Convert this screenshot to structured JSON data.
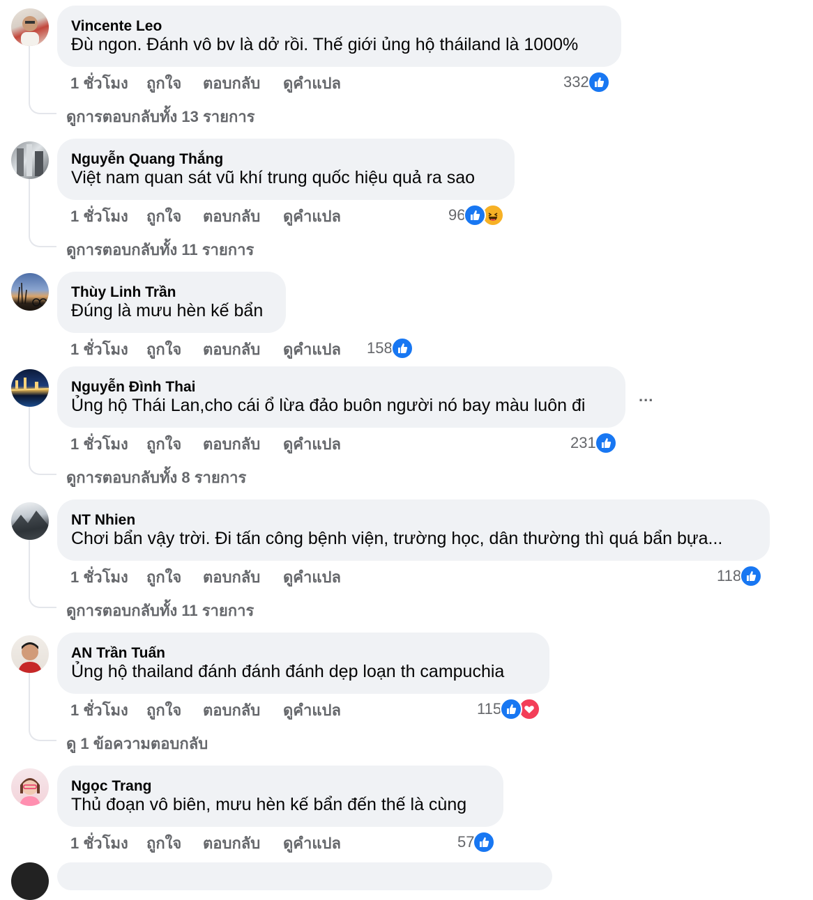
{
  "labels": {
    "time": "1 ชั่วโมง",
    "like": "ถูกใจ",
    "reply": "ตอบกลับ",
    "translate": "ดูคำแปล"
  },
  "colors": {
    "like": "#1877f2",
    "haha": "#f7b125",
    "love": "#f33e58",
    "bubble": "#f0f2f5",
    "muted": "#65676b"
  },
  "comments": [
    {
      "author": "Vincente Leo",
      "text": "Đù ngon. Đánh vô bv là dở rồi. Thế giới ủng hộ tháiland là 1000%",
      "count": "332",
      "reactions": [
        "like-icon"
      ],
      "replies": "ดูการตอบกลับทั้ง 13 รายการ"
    },
    {
      "author": "Nguyễn Quang Thắng",
      "text": "Việt nam quan sát vũ khí trung quốc hiệu quả ra sao",
      "count": "96",
      "reactions": [
        "like-icon",
        "haha-icon"
      ],
      "replies": "ดูการตอบกลับทั้ง 11 รายการ"
    },
    {
      "author": "Thùy Linh Trần",
      "text": "Đúng là mưu hèn kế bẩn",
      "count": "158",
      "reactions": [
        "like-icon"
      ],
      "replies": ""
    },
    {
      "author": "Nguyễn Đình Thai",
      "text": "Ủng hộ Thái Lan,cho cái ổ lừa đảo buôn người nó bay màu luôn đi",
      "count": "231",
      "reactions": [
        "like-icon"
      ],
      "replies": "ดูการตอบกลับทั้ง 8 รายการ",
      "more": "..."
    },
    {
      "author": "NT Nhien",
      "text": "Chơi bẩn vậy trời. Đi tấn công bệnh viện, trường học, dân thường thì quá bẩn bựa...",
      "count": "118",
      "reactions": [
        "like-icon"
      ],
      "replies": "ดูการตอบกลับทั้ง 11 รายการ"
    },
    {
      "author": "AN Trần Tuấn",
      "text": "Ủng hộ thailand đánh đánh đánh dẹp loạn th campuchia",
      "count": "115",
      "reactions": [
        "like-icon",
        "love-icon"
      ],
      "replies": "ดู 1 ข้อความตอบกลับ"
    },
    {
      "author": "Ngọc Trang",
      "text": "Thủ đoạn vô biên, mưu hèn kế bẩn đến thế là cùng",
      "count": "57",
      "reactions": [
        "like-icon"
      ],
      "replies": ""
    }
  ]
}
